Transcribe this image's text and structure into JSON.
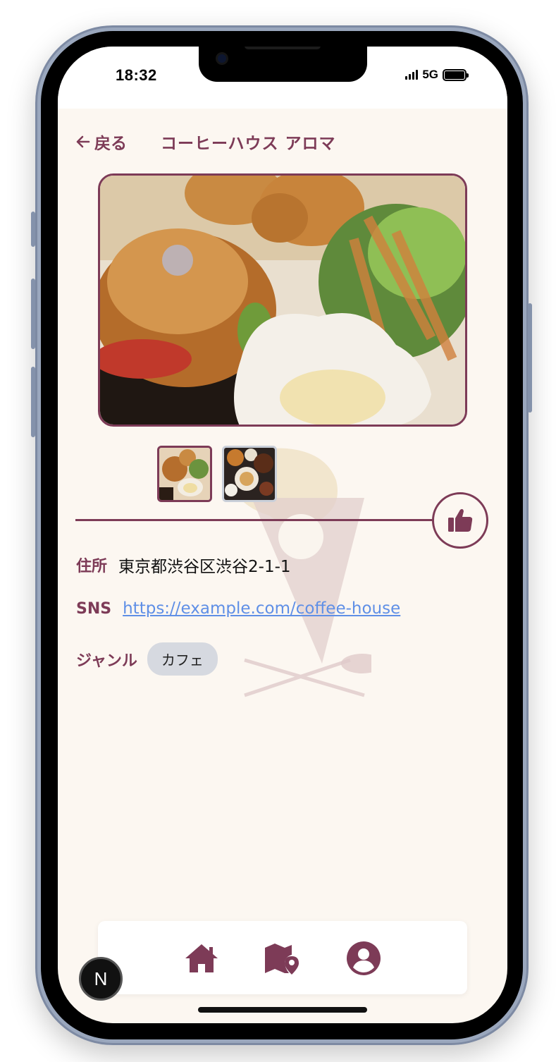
{
  "status_bar": {
    "time": "18:32",
    "network": "5G"
  },
  "header": {
    "back_label": "戻る",
    "title": "コーヒーハウス アロマ"
  },
  "gallery": {
    "main_photo": "food-photo",
    "thumbnails": [
      "food-photo-1",
      "food-photo-2"
    ],
    "selected_index": 0
  },
  "like_button": {
    "icon": "thumbs-up-icon"
  },
  "details": {
    "address_label": "住所",
    "address_value": "東京都渋谷区渋谷2-1-1",
    "sns_label": "SNS",
    "sns_value": "https://example.com/coffee-house",
    "genre_label": "ジャンル",
    "genre_value": "カフェ"
  },
  "bottom_nav": {
    "items": [
      "home-icon",
      "map-pin-icon",
      "user-icon"
    ]
  },
  "badge": {
    "label": "N"
  },
  "colors": {
    "accent": "#7d3b57",
    "background": "#fcf7f1",
    "link": "#5f8fe6",
    "chip": "#d6d9e0"
  }
}
